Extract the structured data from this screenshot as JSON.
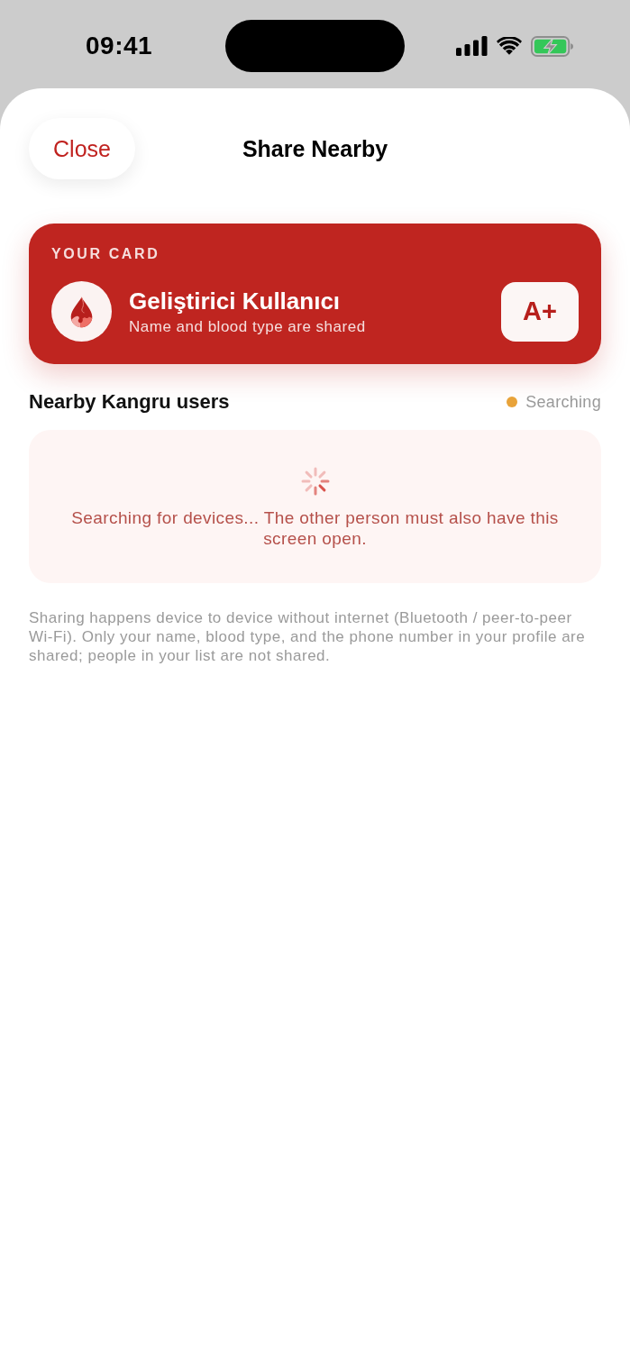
{
  "status_bar": {
    "time": "09:41"
  },
  "header": {
    "close_button": "Close",
    "title": "Share Nearby"
  },
  "your_card": {
    "label": "YOUR CARD",
    "name": "Geliştirici Kullanıcı",
    "subtitle": "Name and blood type are shared",
    "blood_type": "A+"
  },
  "nearby": {
    "title": "Nearby Kangru users",
    "status": {
      "kind": "searching",
      "label": "Searching"
    },
    "empty_message": "Searching for devices... The other person must also have this screen open."
  },
  "footer_note": "Sharing happens device to device without internet (Bluetooth / peer-to-peer Wi-Fi). Only your name, blood type, and the phone number in your profile are shared; people in your list are not shared."
}
